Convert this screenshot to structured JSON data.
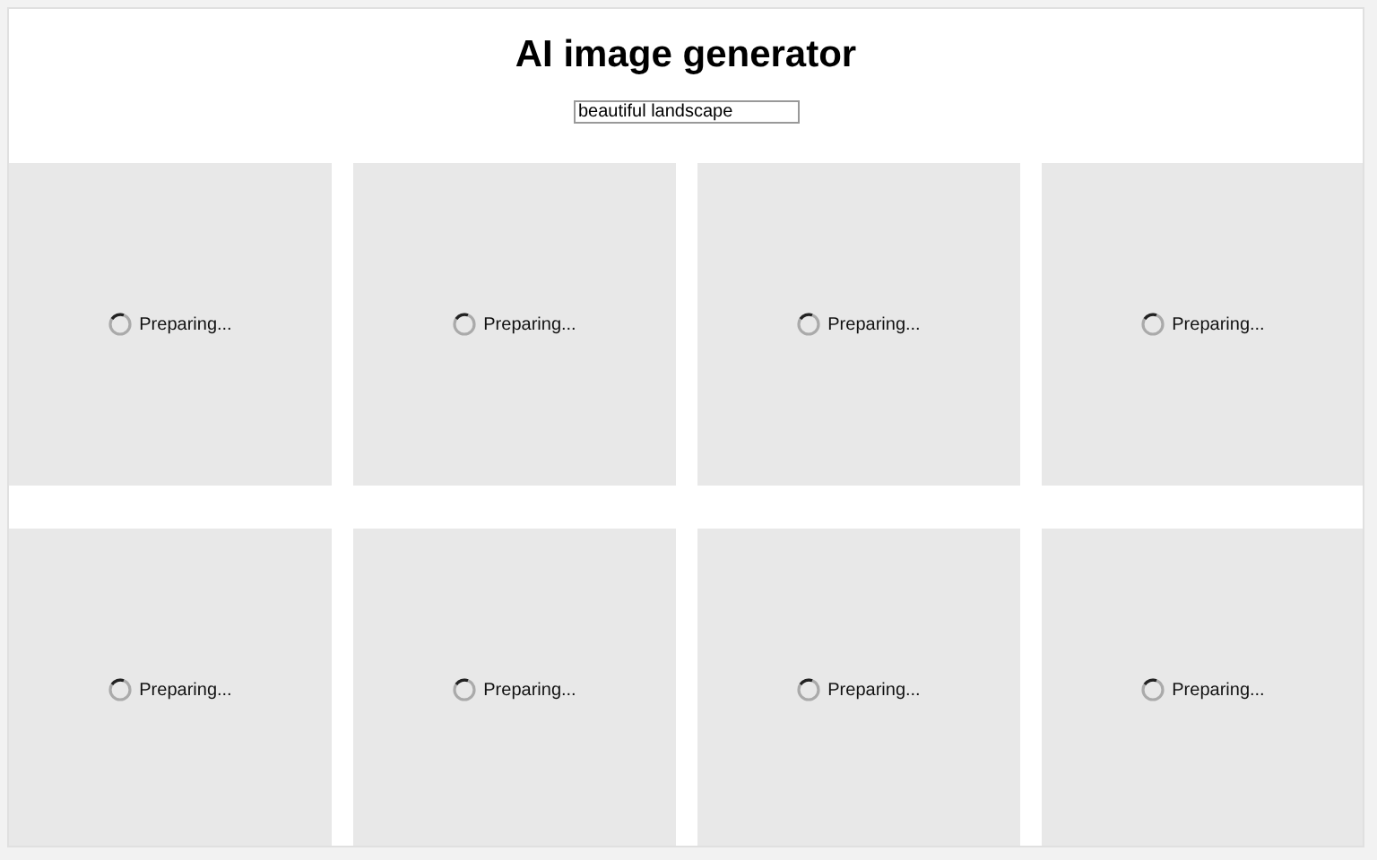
{
  "title": "AI image generator",
  "prompt": {
    "value": "beautiful landscape"
  },
  "tiles": [
    {
      "status": "Preparing..."
    },
    {
      "status": "Preparing..."
    },
    {
      "status": "Preparing..."
    },
    {
      "status": "Preparing..."
    },
    {
      "status": "Preparing..."
    },
    {
      "status": "Preparing..."
    },
    {
      "status": "Preparing..."
    },
    {
      "status": "Preparing..."
    }
  ]
}
